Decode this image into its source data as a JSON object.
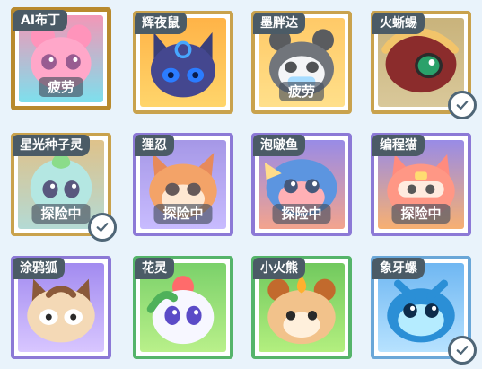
{
  "pets": [
    {
      "name": "AI布丁",
      "status": "疲劳",
      "checked": false,
      "tone": "pink",
      "frame": "gold-selected",
      "bg": "#f07aa3",
      "bg2": "#59d7e8"
    },
    {
      "name": "辉夜鼠",
      "status": "",
      "checked": false,
      "tone": "navy",
      "frame": "gold",
      "bg": "#ffb347",
      "bg2": "#ffd56b"
    },
    {
      "name": "墨胖达",
      "status": "疲劳",
      "checked": false,
      "tone": "panda",
      "frame": "gold",
      "bg": "#ffbb3d",
      "bg2": "#ffd76a"
    },
    {
      "name": "火蜥蜴",
      "status": "",
      "checked": true,
      "tone": "lizard",
      "frame": "gold",
      "bg": "#c9b37b",
      "bg2": "#d9c89a"
    },
    {
      "name": "星光种子灵",
      "status": "探险中",
      "checked": true,
      "tone": "seed",
      "frame": "gold",
      "bg": "#d6b16a",
      "bg2": "#9fd0c9"
    },
    {
      "name": "狸忍",
      "status": "探险中",
      "checked": false,
      "tone": "fox",
      "frame": "purple",
      "bg": "#8d7be0",
      "bg2": "#b9a9ff"
    },
    {
      "name": "泡啵鱼",
      "status": "探险中",
      "checked": false,
      "tone": "fish",
      "frame": "purple",
      "bg": "#7c6be0",
      "bg2": "#f08a6e"
    },
    {
      "name": "编程猫",
      "status": "探险中",
      "checked": false,
      "tone": "cat",
      "frame": "purple",
      "bg": "#7c6be0",
      "bg2": "#f59a4a"
    },
    {
      "name": "涂鸦狐",
      "status": "",
      "checked": false,
      "tone": "doodle",
      "frame": "purple",
      "bg": "#a28bf0",
      "bg2": "#d8c6ff"
    },
    {
      "name": "花灵",
      "status": "",
      "checked": false,
      "tone": "flower",
      "frame": "green",
      "bg": "#7bd16a",
      "bg2": "#b9f08a"
    },
    {
      "name": "小火熊",
      "status": "",
      "checked": false,
      "tone": "bear",
      "frame": "green",
      "bg": "#71c95e",
      "bg2": "#b3ef7f"
    },
    {
      "name": "象牙螺",
      "status": "",
      "checked": true,
      "tone": "shell",
      "frame": "blue",
      "bg": "#6fb7f2",
      "bg2": "#b7e2ff"
    }
  ]
}
